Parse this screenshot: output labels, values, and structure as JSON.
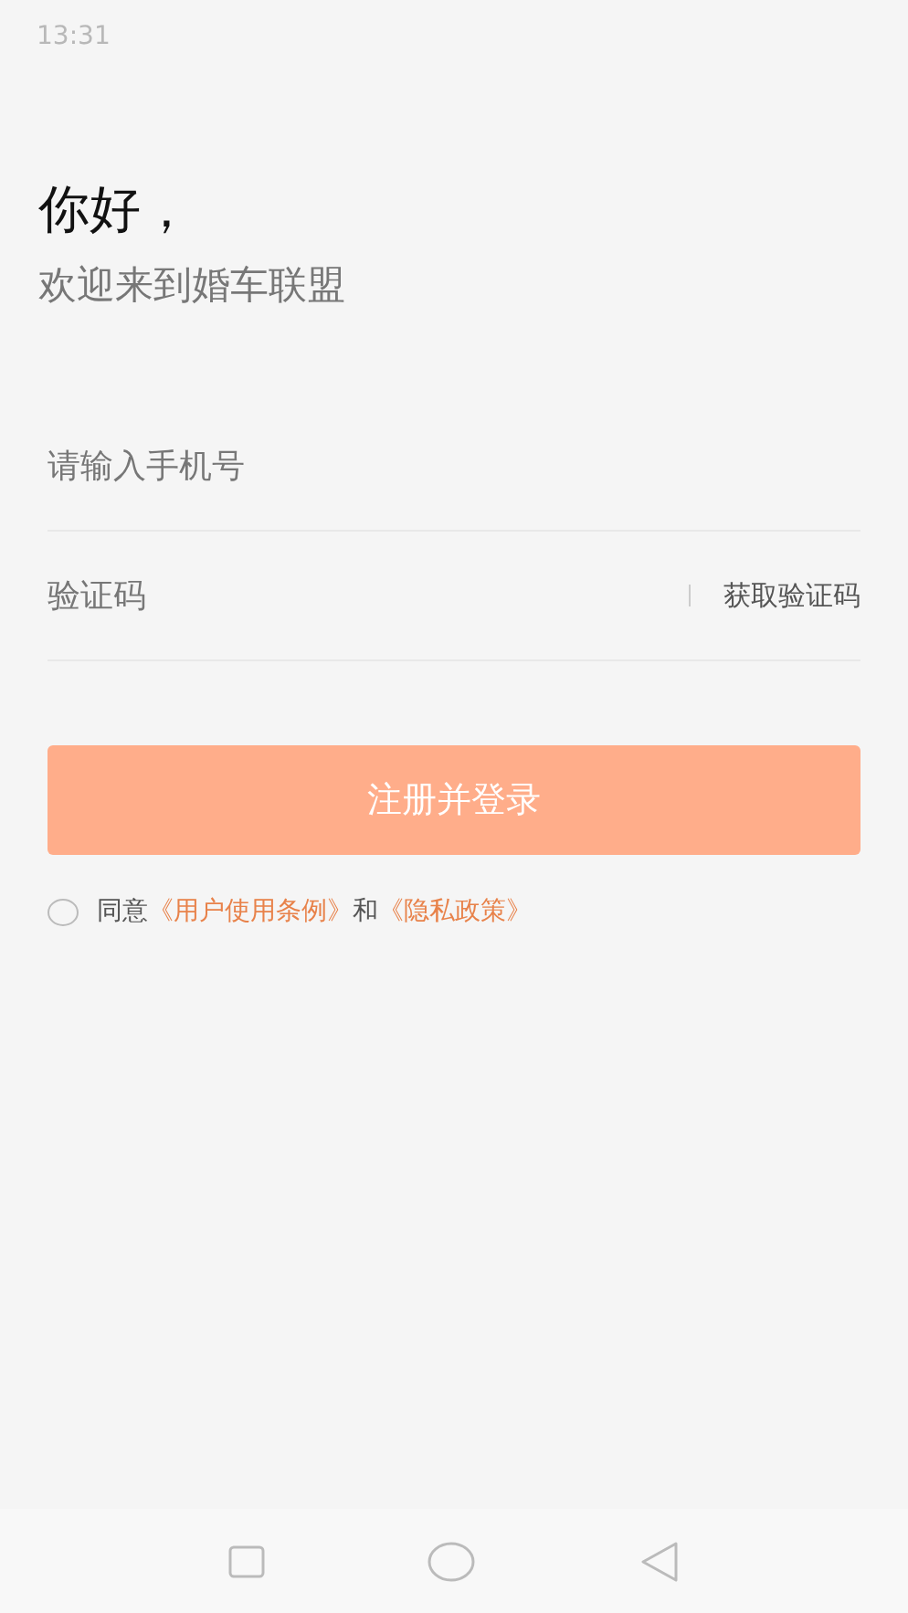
{
  "status_bar": {
    "time": "13:31"
  },
  "greeting": {
    "title": "你好，",
    "subtitle": "欢迎来到婚车联盟"
  },
  "phone_field": {
    "placeholder": "请输入手机号"
  },
  "code_field": {
    "placeholder": "验证码",
    "action": "获取验证码"
  },
  "submit_button": {
    "label": "注册并登录",
    "disabled": true
  },
  "agreement": {
    "checked": false,
    "prefix": "同意",
    "link_1": "《用户使用条例》",
    "middle": "和",
    "link_2": "《隐私政策》"
  }
}
